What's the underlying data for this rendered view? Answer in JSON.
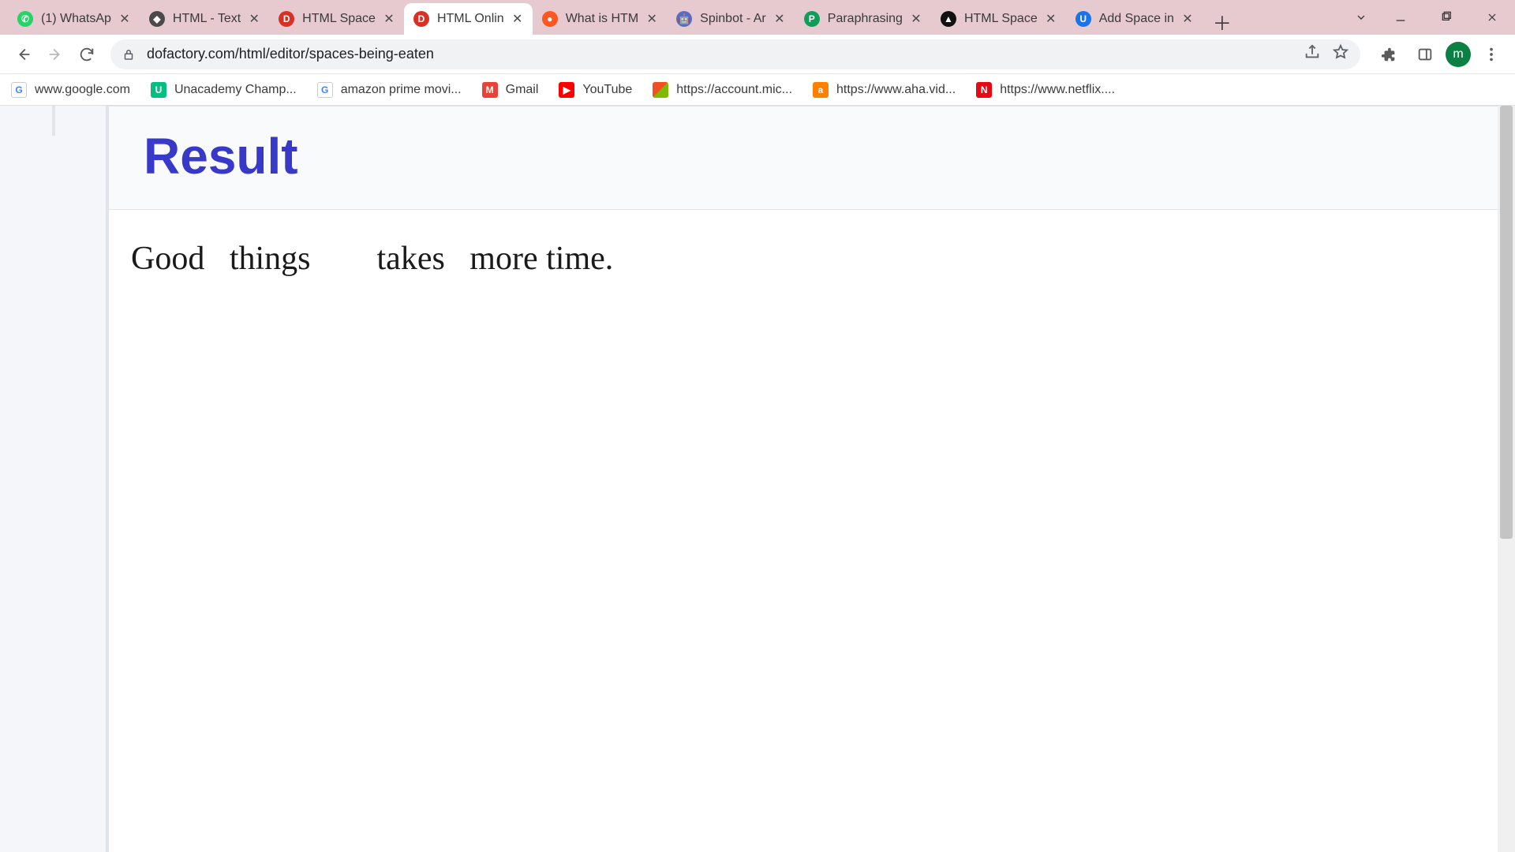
{
  "browser": {
    "tabs": [
      {
        "label": "(1) WhatsAp"
      },
      {
        "label": "HTML - Text"
      },
      {
        "label": "HTML Space"
      },
      {
        "label": "HTML Onlin"
      },
      {
        "label": "What is HTM"
      },
      {
        "label": "Spinbot - Ar"
      },
      {
        "label": "Paraphrasing"
      },
      {
        "label": "HTML Space"
      },
      {
        "label": "Add Space in"
      }
    ],
    "url": "dofactory.com/html/editor/spaces-being-eaten",
    "avatar_initial": "m"
  },
  "bookmarks": [
    {
      "label": "www.google.com"
    },
    {
      "label": "Unacademy Champ..."
    },
    {
      "label": "amazon prime movi..."
    },
    {
      "label": "Gmail"
    },
    {
      "label": "YouTube"
    },
    {
      "label": "https://account.mic..."
    },
    {
      "label": "https://www.aha.vid..."
    },
    {
      "label": "https://www.netflix...."
    }
  ],
  "page": {
    "result_heading": "Result",
    "result_text": "Good   things        takes   more time."
  }
}
